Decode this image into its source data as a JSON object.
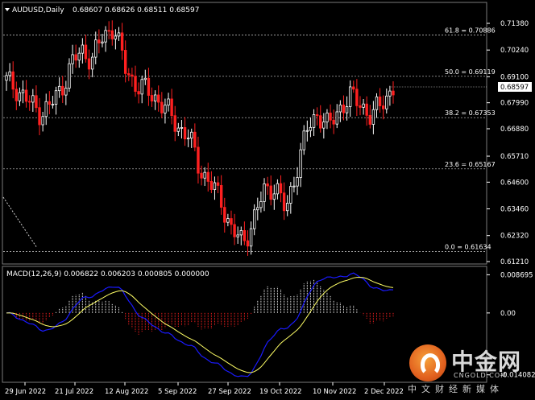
{
  "chart": {
    "title": "AUDUSD,Daily",
    "ohlc": "0.68607 0.68626 0.68511 0.68597",
    "price_label": "0.68597",
    "price_ticks": [
      "0.71380",
      "0.70240",
      "0.69100",
      "0.67990",
      "0.66880",
      "0.65710",
      "0.64600",
      "0.63460",
      "0.62320",
      "0.61210"
    ],
    "price_tick_values": [
      0.7138,
      0.7024,
      0.691,
      0.6799,
      0.6688,
      0.6571,
      0.646,
      0.6346,
      0.6232,
      0.6121
    ],
    "fib_levels": [
      {
        "label": "61.8 = 0.70886",
        "value": 0.70886
      },
      {
        "label": "50.0 = 0.69119",
        "value": 0.69119
      },
      {
        "label": "38.2 = 0.67353",
        "value": 0.67353
      },
      {
        "label": "23.6 = 0.65167",
        "value": 0.65167
      },
      {
        "label": "0.0 = 0.61634",
        "value": 0.61634
      }
    ],
    "ylim": [
      0.6121,
      0.7138
    ],
    "colors": {
      "bull": "#ffffff",
      "bear": "#ff2020",
      "macd_line": "#1a1aff",
      "signal_line": "#ffff66",
      "fib": "#ffffff",
      "ask_line": "#cfcfcf"
    }
  },
  "indicator": {
    "title": "MACD(12,26,9) 0.006822 0.006203 0.000805 0.000000",
    "ticks": [
      "0.008695",
      "0.00",
      "-0.014082"
    ],
    "tick_values": [
      0.008695,
      0.0,
      -0.014082
    ]
  },
  "xaxis": {
    "labels": [
      "29 Jun 2022",
      "21 Jul 2022",
      "12 Aug 2022",
      "5 Sep 2022",
      "27 Sep 2022",
      "19 Oct 2022",
      "10 Nov 2022",
      "2 Dec 2022"
    ]
  },
  "watermark": {
    "name": "中金网",
    "domain": "CNGOLD.COM",
    "slogan": "中文财经新媒体"
  },
  "chart_data": {
    "type": "candlestick",
    "title": "AUDUSD,Daily",
    "x": [
      "29 Jun 2022",
      "21 Jul 2022",
      "12 Aug 2022",
      "5 Sep 2022",
      "27 Sep 2022",
      "19 Oct 2022",
      "10 Nov 2022",
      "2 Dec 2022"
    ],
    "close_path": [
      0.689,
      0.686,
      0.6805,
      0.676,
      0.678,
      0.685,
      0.696,
      0.702,
      0.699,
      0.708,
      0.713,
      0.695,
      0.688,
      0.685,
      0.682,
      0.676,
      0.67,
      0.665,
      0.652,
      0.645,
      0.638,
      0.625,
      0.62,
      0.63,
      0.642,
      0.645,
      0.633,
      0.652,
      0.668,
      0.676,
      0.669,
      0.678,
      0.682,
      0.68,
      0.673,
      0.681,
      0.686
    ],
    "ylim": [
      0.6121,
      0.7138
    ]
  }
}
